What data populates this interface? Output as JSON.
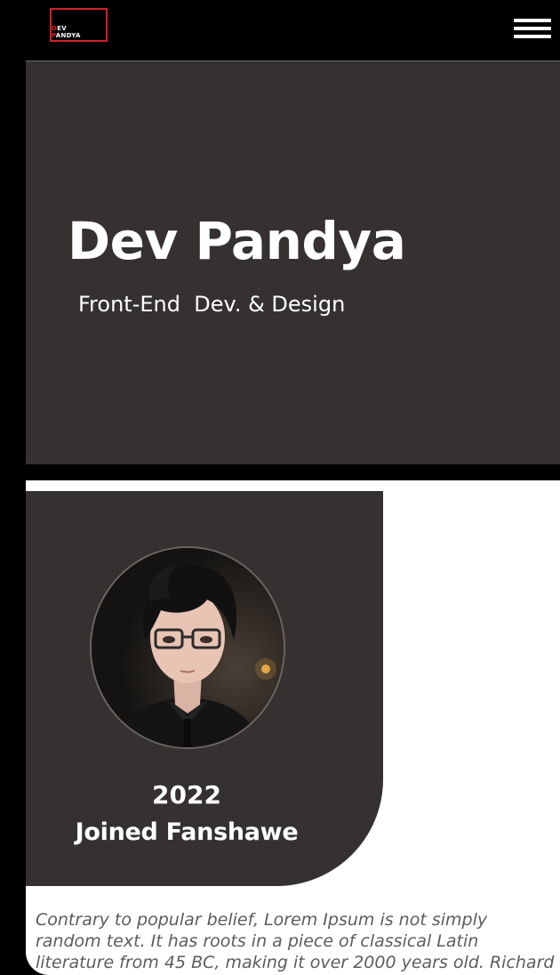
{
  "header": {
    "logo_line1": "DEV",
    "logo_line2": "PANDYA",
    "menu_icon": "hamburger-menu-icon",
    "accent_color": "#d42027"
  },
  "hero": {
    "title": "Dev Pandya",
    "subtitle": "Front-End  Dev. & Design"
  },
  "about": {
    "avatar_icon": "avatar-portrait",
    "year": "2022",
    "milestone": "Joined Fanshawe",
    "text_lines": [
      "Contrary to popular belief, Lorem Ipsum is not simply",
      "random text. It has roots in a piece of classical Latin",
      "literature from 45 BC, making it over 2000 years old. Richard"
    ]
  },
  "colors": {
    "background": "#000000",
    "panel": "#353131",
    "text_light": "#ffffff",
    "text_muted": "#5c5c5c"
  }
}
